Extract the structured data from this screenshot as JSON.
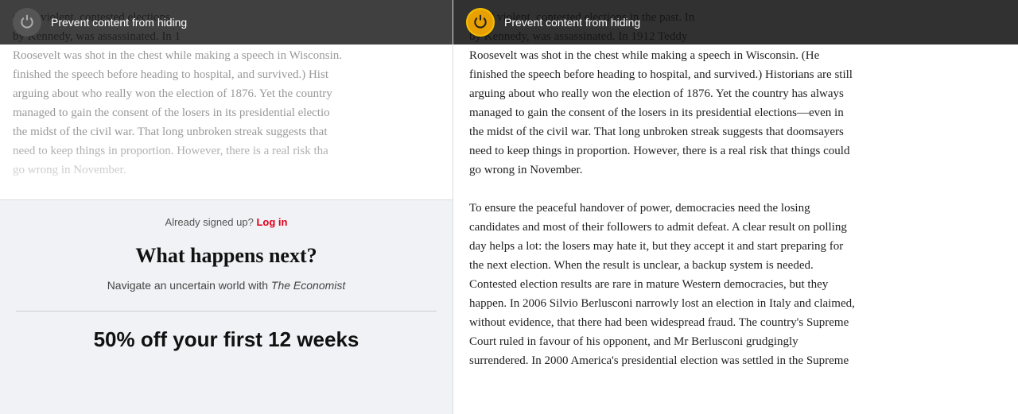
{
  "left": {
    "prevent_bar": {
      "label": "Prevent content from hiding"
    },
    "article_text_visible": "s had violent, contested elections by Kennedy, was assassinated. In 1",
    "article_text_middle": "Roosevelt was shot in the chest while making a speech in Wisconsin. finished the speech before heading to hospital, and survived.) Hist arguing about who really won the election of 1876. Yet the country managed to gain the consent of the losers in its presidential electio the midst of the civil war. That long unbroken streak suggests that need to keep things in proportion. However, there is a real risk tha go wrong in November.",
    "signup": {
      "already_text": "Already signed up?",
      "login_label": "Log in",
      "headline": "What happens next?",
      "subtext_before": "Navigate an uncertain world with ",
      "subtext_brand": "The Economist",
      "offer": "50% off your first 12 weeks"
    }
  },
  "right": {
    "prevent_bar": {
      "label": "Prevent content from hiding"
    },
    "article_paragraphs": [
      "s had violent, contested elections in the past. In by Kennedy, was assassinated. In 1912 Teddy Roosevelt was shot in the chest while making a speech in Wisconsin. (He finished the speech before heading to hospital, and survived.) Historians are still arguing about who really won the election of 1876. Yet the country has always managed to gain the consent of the losers in its presidential elections—even in the midst of the civil war. That long unbroken streak suggests that doomsayers need to keep things in proportion. However, there is a real risk that things could go wrong in November.",
      "To ensure the peaceful handover of power, democracies need the losing candidates and most of their followers to admit defeat. A clear result on polling day helps a lot: the losers may hate it, but they accept it and start preparing for the next election. When the result is unclear, a backup system is needed. Contested election results are rare in mature Western democracies, but they happen. In 2006 Silvio Berlusconi narrowly lost an election in Italy and claimed, without evidence, that there had been widespread fraud. The country's Supreme Court ruled in favour of his opponent, and Mr Berlusconi grudgingly surrendered. In 2000 America's presidential election was settled in the Supreme"
    ]
  }
}
